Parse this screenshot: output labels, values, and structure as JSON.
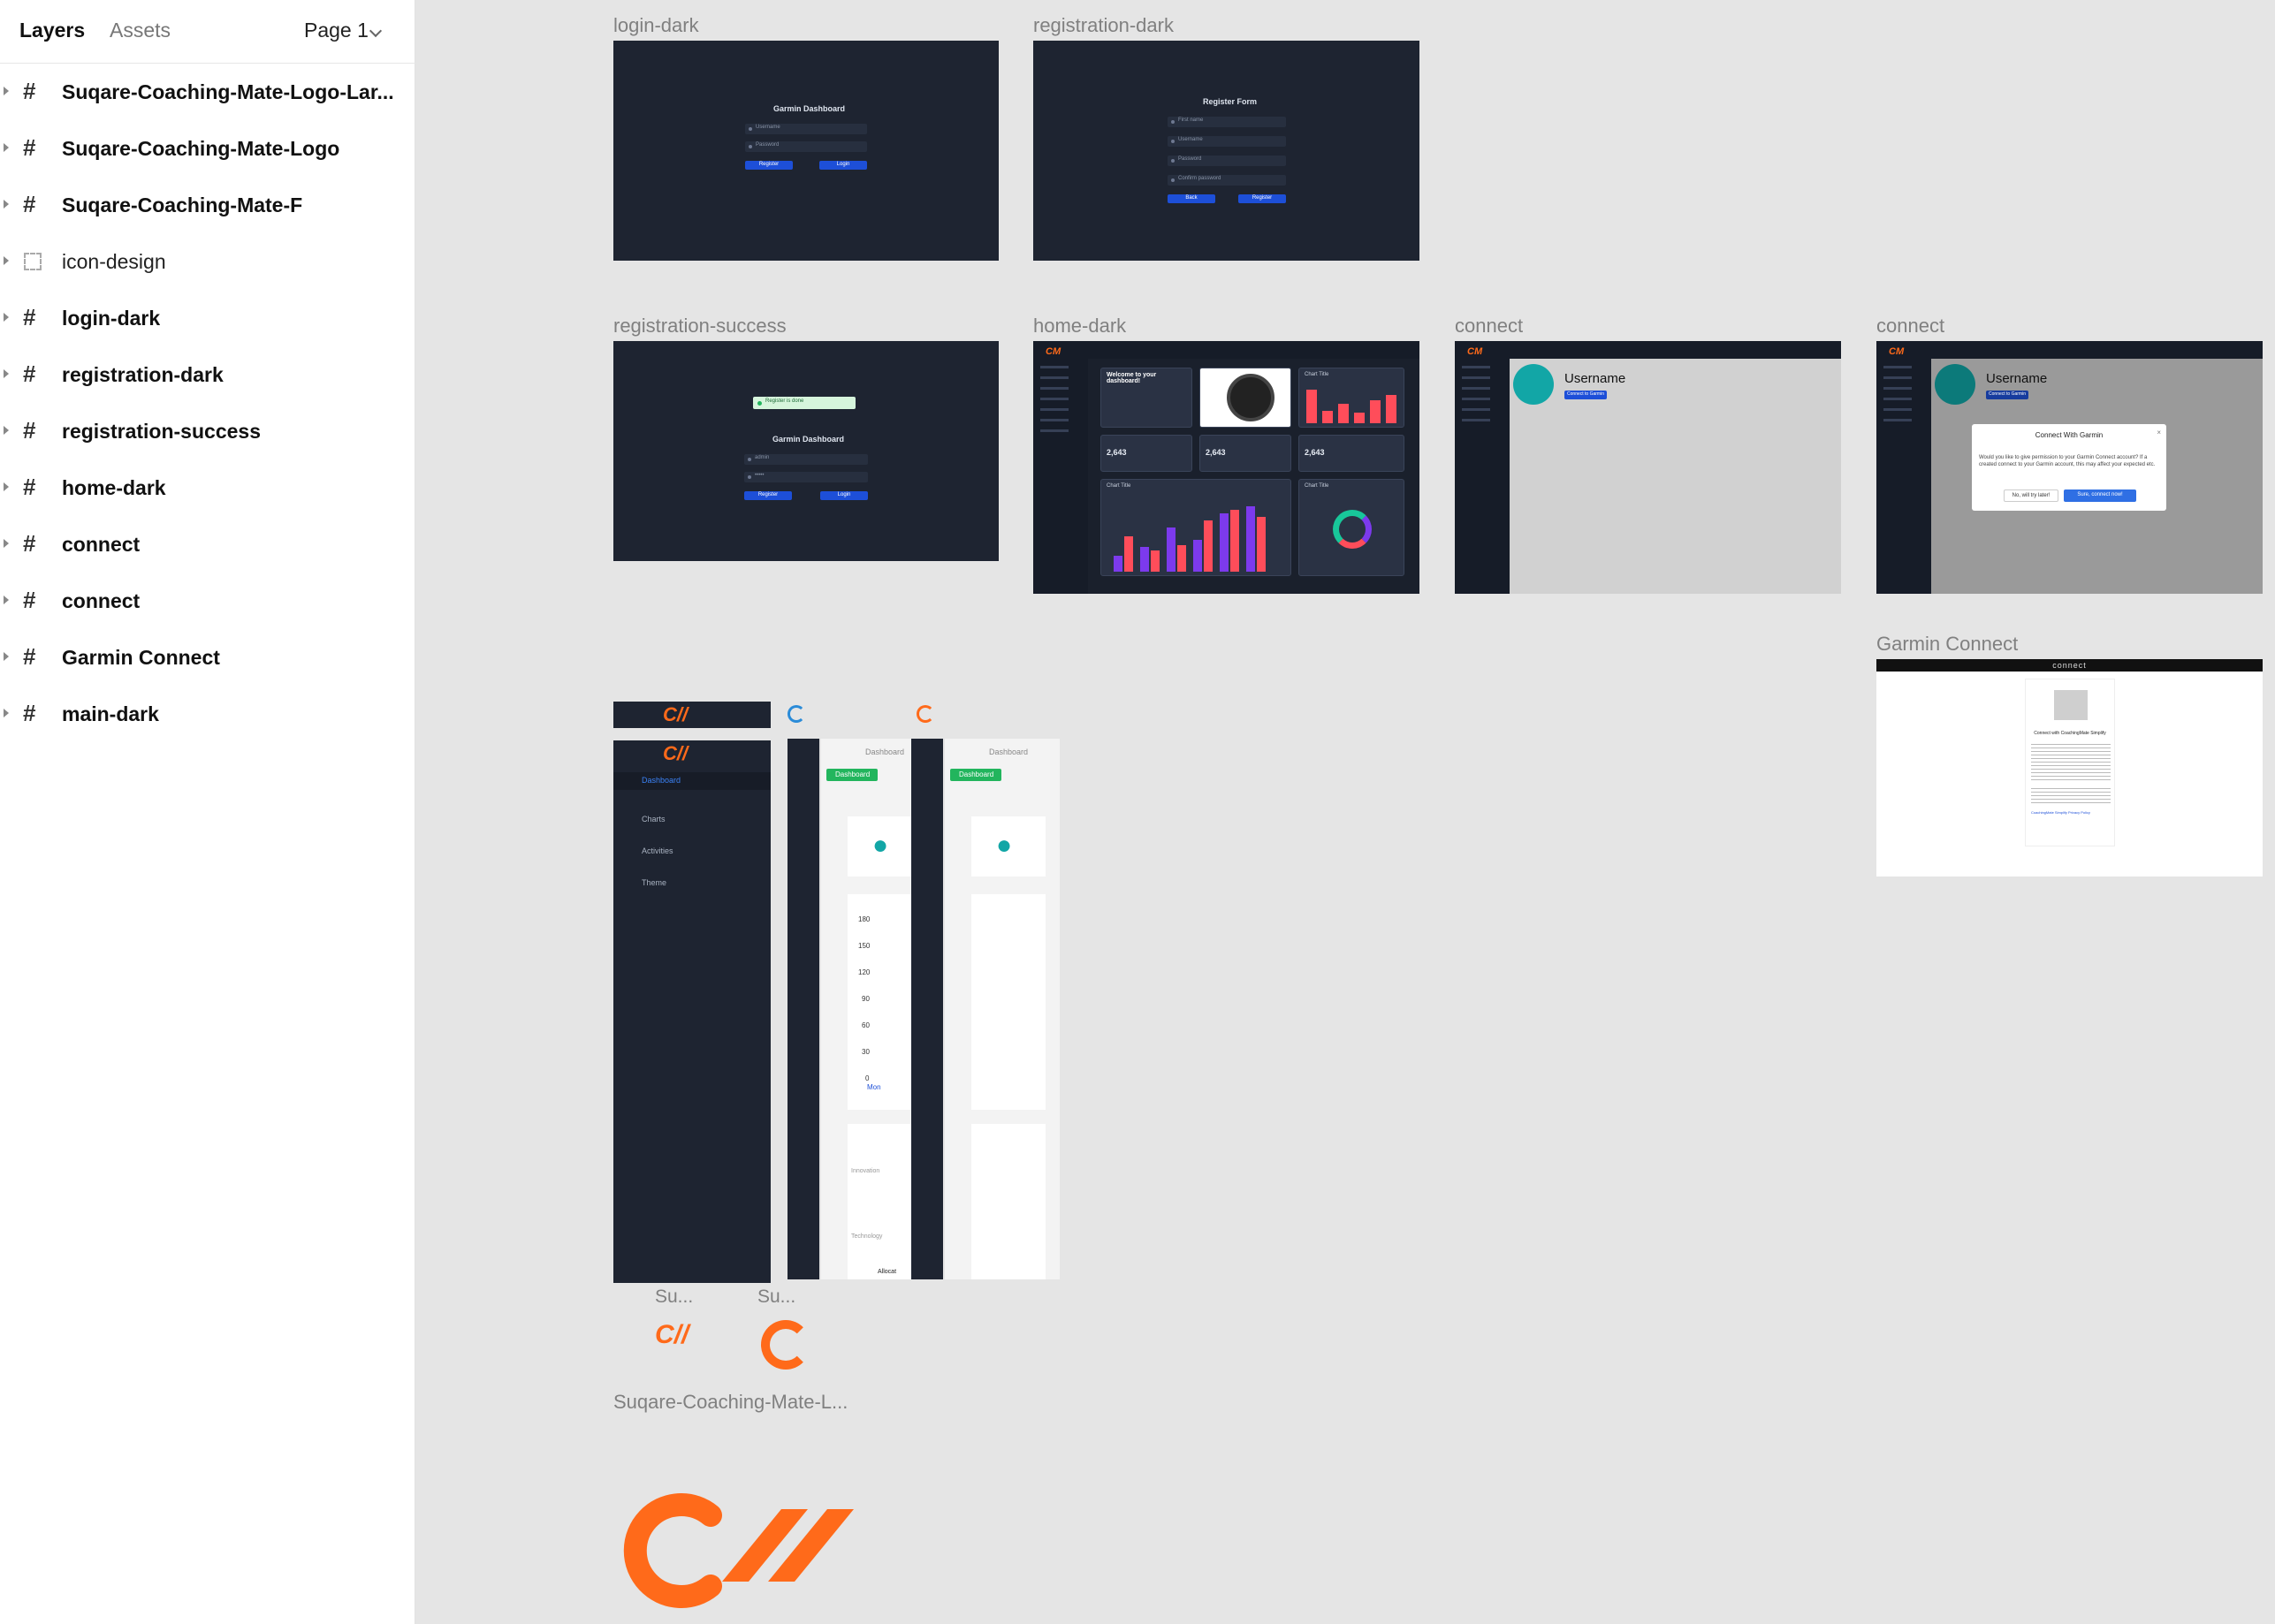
{
  "panel": {
    "tabs": {
      "layers": "Layers",
      "assets": "Assets"
    },
    "page": "Page 1",
    "layers": [
      {
        "name": "Suqare-Coaching-Mate-Logo-Lar...",
        "kind": "frame"
      },
      {
        "name": "Suqare-Coaching-Mate-Logo",
        "kind": "frame"
      },
      {
        "name": "Suqare-Coaching-Mate-F",
        "kind": "frame"
      },
      {
        "name": "icon-design",
        "kind": "section"
      },
      {
        "name": "login-dark",
        "kind": "frame"
      },
      {
        "name": "registration-dark",
        "kind": "frame"
      },
      {
        "name": "registration-success",
        "kind": "frame"
      },
      {
        "name": "home-dark",
        "kind": "frame"
      },
      {
        "name": "connect",
        "kind": "frame"
      },
      {
        "name": "connect",
        "kind": "frame"
      },
      {
        "name": "Garmin Connect",
        "kind": "frame"
      },
      {
        "name": "main-dark",
        "kind": "frame"
      }
    ]
  },
  "canvas": {
    "frames": {
      "login_dark": {
        "label": "login-dark",
        "title": "Garmin Dashboard",
        "username": "Username",
        "password": "Password",
        "register": "Register",
        "login": "Login"
      },
      "registration_dark": {
        "label": "registration-dark",
        "title": "Register Form",
        "first": "First name",
        "user": "Username",
        "pass": "Password",
        "confirm": "Confirm password",
        "back": "Back",
        "register": "Register"
      },
      "registration_success": {
        "label": "registration-success",
        "banner": "Register is done",
        "title": "Garmin Dashboard",
        "username": "admin",
        "password": "•••••",
        "register": "Register",
        "login": "Login"
      },
      "home_dark": {
        "label": "home-dark",
        "welcome": "Welcome to your dashboard!",
        "chart": "Chart Title",
        "stat": "2,643"
      },
      "connect1": {
        "label": "connect",
        "username": "Username",
        "btn": "Connect to Garmin"
      },
      "connect2": {
        "label": "connect",
        "username": "Username",
        "btn": "Connect to Garmin",
        "modal_title": "Connect With Garmin",
        "modal_body": "Would you like to give permission to your Garmin Connect account? If a created connect to your Garmin account, this may affect your expected etc.",
        "no": "No, will try later!",
        "yes": "Sure, connect now!"
      },
      "garmin_connect": {
        "label": "Garmin Connect",
        "brand": "connect",
        "heading": "Connect with CoachingMate Simplify",
        "link": "CoachingMate Simplify Privacy Policy"
      }
    },
    "icon_design": {
      "menu": [
        "Dashboard",
        "Charts",
        "Activities",
        "Theme"
      ],
      "crumb": "Dashboard",
      "pill": "Dashboard",
      "yticks": [
        "180",
        "150",
        "120",
        "90",
        "60",
        "30",
        "0"
      ],
      "xtick": "Mon",
      "cats": [
        "Innovation",
        "Technology"
      ],
      "legend": "Allocat",
      "small_labels": [
        "Su...",
        "Su..."
      ],
      "group_label": "Suqare-Coaching-Mate-L..."
    },
    "colors": {
      "orange": "#ff6a1a",
      "dark": "#1e2431",
      "teal": "#12a6a6",
      "green": "#22b55d",
      "blue": "#1d4fd8"
    }
  }
}
